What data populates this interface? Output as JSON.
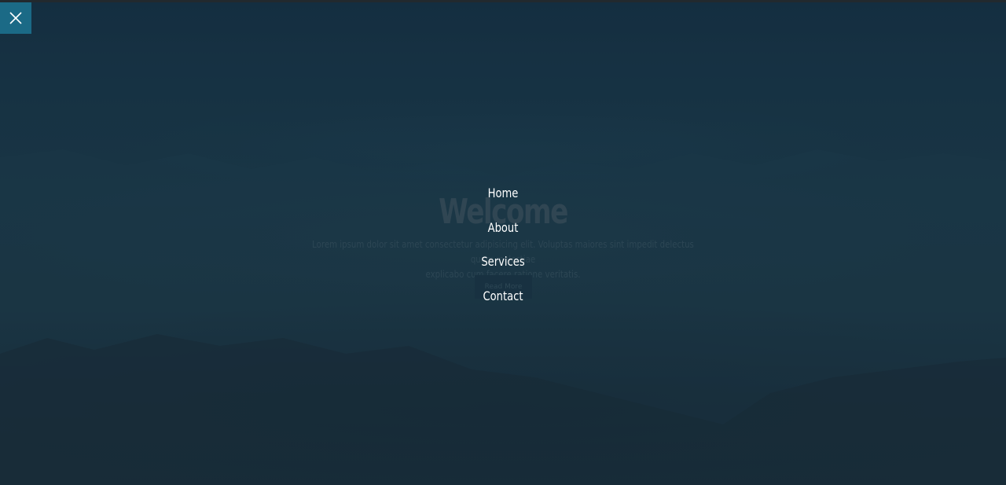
{
  "overlay_menu": {
    "close_icon": "close-icon",
    "items": [
      {
        "label": "Home"
      },
      {
        "label": "About"
      },
      {
        "label": "Services"
      },
      {
        "label": "Contact"
      }
    ]
  },
  "hero": {
    "title": "Welcome",
    "text_line1": "Lorem ipsum dolor sit amet consectetur adipisicing elit. Voluptas maiores sint impedit delectus quam molestiae",
    "text_line2": "explicabo cum facere ratione veritatis.",
    "button_label": "Read More"
  },
  "colors": {
    "close_button_bg": "#1b6a86",
    "background_top": "#153246",
    "background_bottom": "#1b2a35",
    "nav_text": "#ffffff"
  }
}
